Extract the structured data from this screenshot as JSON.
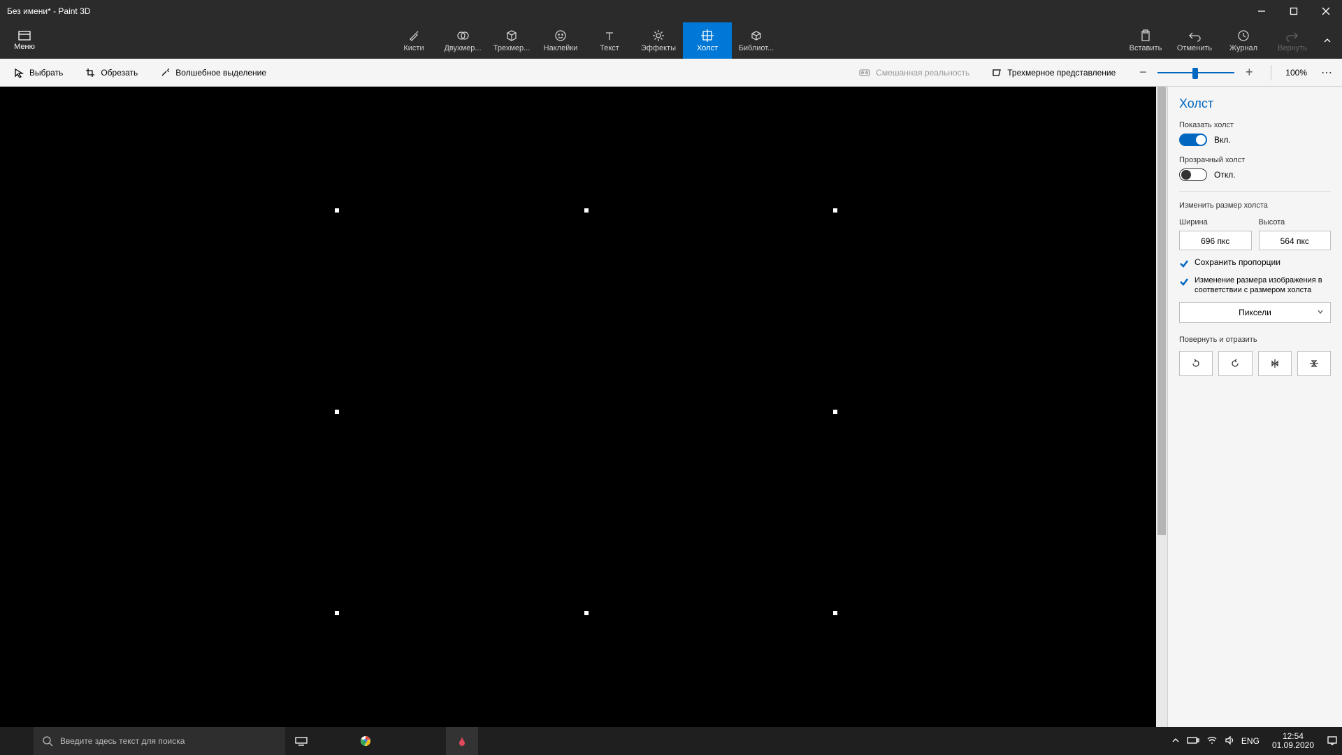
{
  "title": "Без имени* - Paint 3D",
  "menu_label": "Меню",
  "ribbon": {
    "tabs": [
      {
        "label": "Кисти"
      },
      {
        "label": "Двухмер..."
      },
      {
        "label": "Трехмер..."
      },
      {
        "label": "Наклейки"
      },
      {
        "label": "Текст"
      },
      {
        "label": "Эффекты"
      },
      {
        "label": "Холст"
      },
      {
        "label": "Библиот..."
      }
    ],
    "right": [
      {
        "label": "Вставить"
      },
      {
        "label": "Отменить"
      },
      {
        "label": "Журнал"
      },
      {
        "label": "Вернуть"
      }
    ]
  },
  "subbar": {
    "select": "Выбрать",
    "crop": "Обрезать",
    "magic": "Волшебное выделение",
    "mixed": "Смешанная реальность",
    "view3d": "Трехмерное представление",
    "zoom": "100%"
  },
  "panel": {
    "title": "Холст",
    "show_canvas": "Показать холст",
    "show_state": "Вкл.",
    "transparent": "Прозрачный холст",
    "trans_state": "Откл.",
    "resize": "Изменить размер холста",
    "width_lbl": "Ширина",
    "height_lbl": "Высота",
    "width": "696 пкс",
    "height": "564 пкс",
    "keep_aspect": "Сохранить пропорции",
    "scale_image": "Изменение размера изображения в соответствии с размером холста",
    "units": "Пиксели",
    "rotate_flip": "Повернуть и отразить"
  },
  "taskbar": {
    "search_placeholder": "Введите здесь текст для поиска",
    "lang": "ENG",
    "time": "12:54",
    "date": "01.09.2020"
  }
}
